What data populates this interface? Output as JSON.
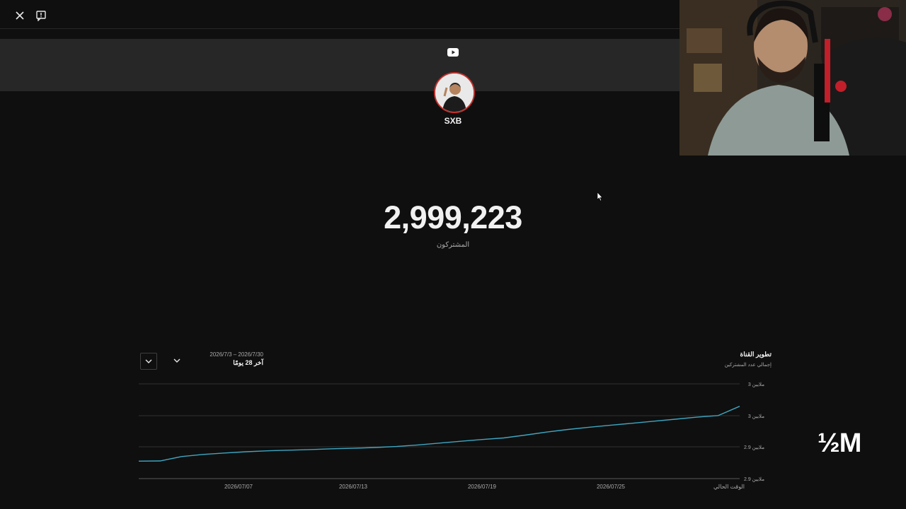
{
  "header": {
    "close_icon": "close-icon",
    "feedback_icon": "feedback-icon"
  },
  "channel": {
    "name": "SXB",
    "subscriber_count": "2,999,223",
    "subscriber_label": "المشترکون"
  },
  "chart_panel": {
    "title": "تطوير القناة",
    "subtitle": "إجمالي عدد المشتركين",
    "date_range": "2026/7/3 – 2026/7/30",
    "period_label": "آخر 28 يومًا"
  },
  "chart_data": {
    "type": "line",
    "title": "تطوير القناة",
    "xlabel": "",
    "ylabel": "",
    "x_ticks": [
      "2026/07/07",
      "2026/07/13",
      "2026/07/19",
      "2026/07/25",
      "الوقت الحالي"
    ],
    "y_ticks": [
      "3 ملايين",
      "3 ملايين",
      "2.9 ملايين",
      "2.9 ملايين"
    ],
    "ylim": [
      2899000,
      3002000
    ],
    "grid": true,
    "series": [
      {
        "color": "#3ea6c1",
        "x": [
          "2026/07/02",
          "2026/07/03",
          "2026/07/04",
          "2026/07/05",
          "2026/07/06",
          "2026/07/07",
          "2026/07/08",
          "2026/07/09",
          "2026/07/10",
          "2026/07/11",
          "2026/07/12",
          "2026/07/13",
          "2026/07/14",
          "2026/07/15",
          "2026/07/16",
          "2026/07/17",
          "2026/07/18",
          "2026/07/19",
          "2026/07/20",
          "2026/07/21",
          "2026/07/22",
          "2026/07/23",
          "2026/07/24",
          "2026/07/25",
          "2026/07/26",
          "2026/07/27",
          "2026/07/28",
          "2026/07/29",
          "2026/07/30"
        ],
        "values": [
          2918000,
          2918200,
          2923000,
          2925300,
          2926800,
          2928200,
          2929200,
          2929900,
          2930600,
          2931400,
          2932000,
          2932800,
          2933900,
          2935600,
          2937600,
          2939600,
          2941500,
          2943200,
          2946300,
          2949600,
          2952400,
          2954900,
          2957100,
          2959200,
          2961400,
          2963600,
          2965800,
          2967600,
          2977600
        ]
      }
    ]
  },
  "overlay": {
    "badge": "½M"
  },
  "colors": {
    "background": "#0f0f0f",
    "banner": "#272727",
    "line": "#3ea6c1",
    "grid": "#303030"
  }
}
